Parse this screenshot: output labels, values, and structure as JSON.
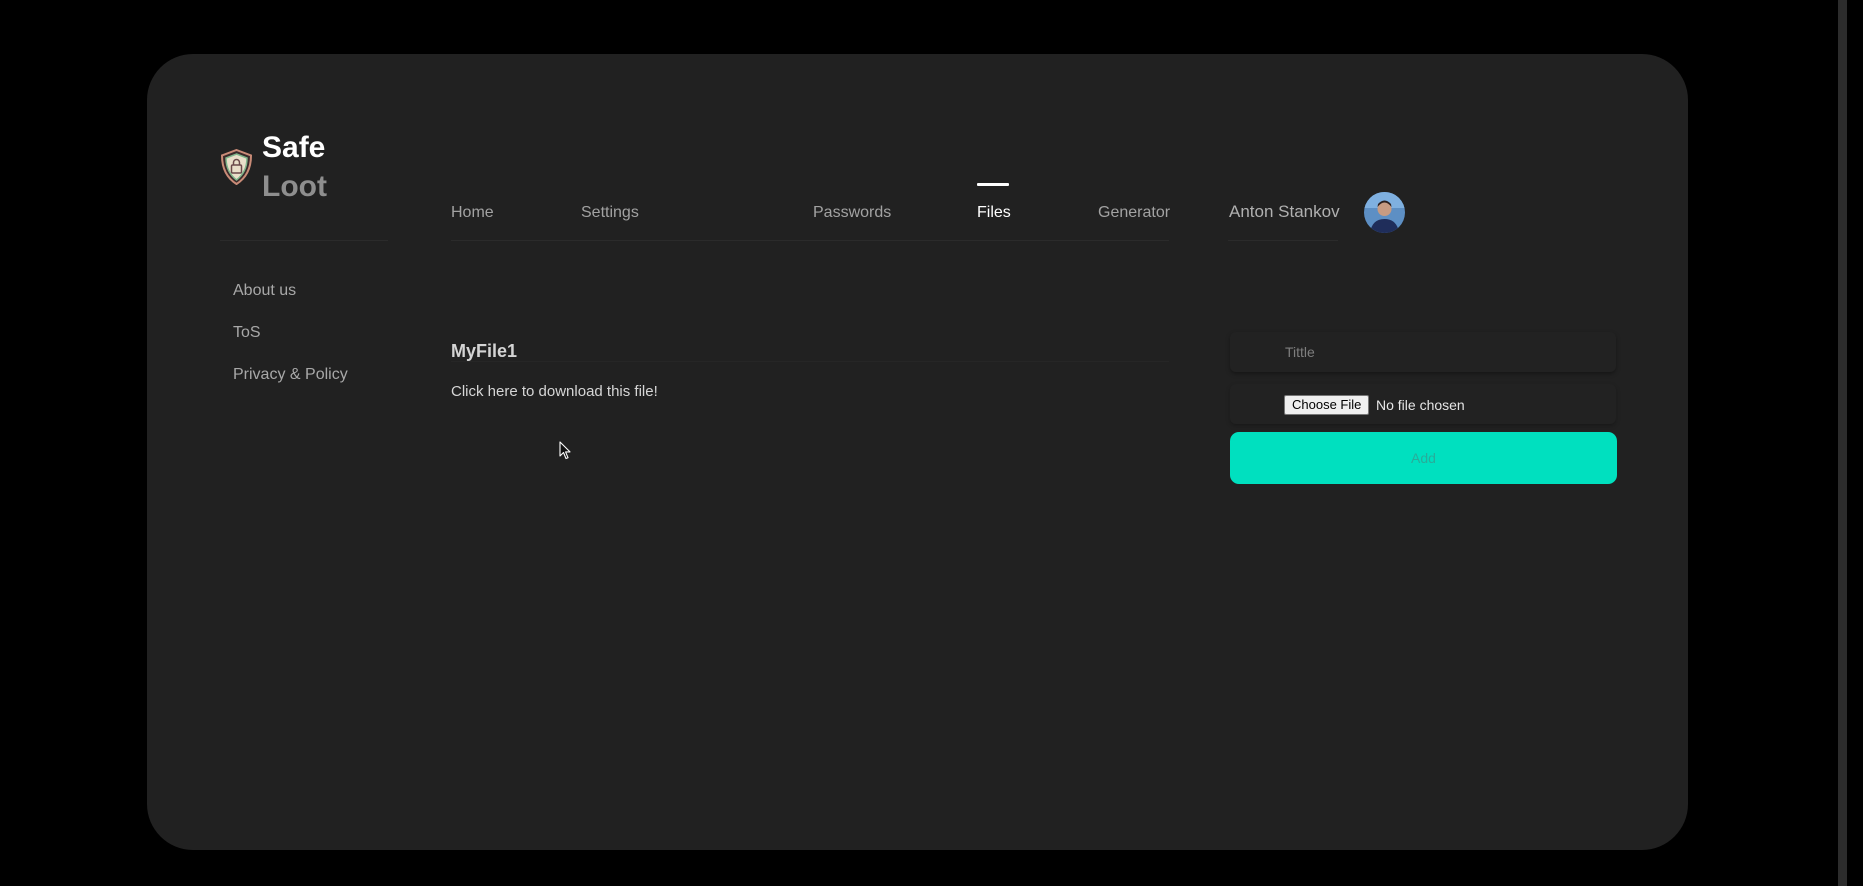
{
  "logo": {
    "line1": "Safe",
    "line2": "Loot",
    "icon": "shield-lock-icon"
  },
  "sidebar": {
    "items": [
      {
        "label": "About us"
      },
      {
        "label": "ToS"
      },
      {
        "label": "Privacy & Policy"
      }
    ]
  },
  "nav": {
    "items": [
      {
        "label": "Home"
      },
      {
        "label": "Settings"
      },
      {
        "label": "Passwords"
      },
      {
        "label": "Files"
      },
      {
        "label": "Generator"
      }
    ],
    "active": "Files"
  },
  "user": {
    "name": "Anton Stankov",
    "avatar_icon": "user-avatar"
  },
  "files": [
    {
      "title": "MyFile1",
      "link_text": "Click here to download this file!"
    }
  ],
  "upload_form": {
    "title_placeholder": "Tittle",
    "choose_file_label": "Choose File",
    "no_file_text": "No file chosen",
    "add_label": "Add"
  },
  "colors": {
    "accent": "#00e0bf",
    "card_background": "#212121",
    "page_background": "#000000"
  }
}
